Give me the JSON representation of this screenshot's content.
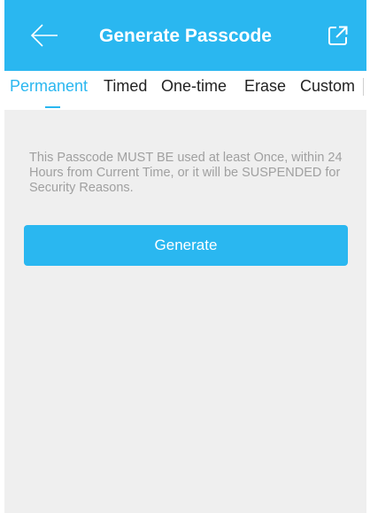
{
  "header": {
    "title": "Generate Passcode",
    "back_icon": "arrow-left-icon",
    "share_icon": "external-link-icon"
  },
  "tabs": [
    {
      "label": "Permanent",
      "active": true
    },
    {
      "label": "Timed",
      "active": false
    },
    {
      "label": "One-time",
      "active": false
    },
    {
      "label": "Erase",
      "active": false
    },
    {
      "label": "Custom",
      "active": false
    }
  ],
  "content": {
    "notice": "This Passcode MUST BE used at least Once, within 24 Hours from Current Time, or it will be SUSPENDED for Security Reasons.",
    "generate_label": "Generate"
  },
  "colors": {
    "accent": "#2ab7f0",
    "content_bg": "#efefef",
    "notice_text": "#a0a0a0"
  }
}
